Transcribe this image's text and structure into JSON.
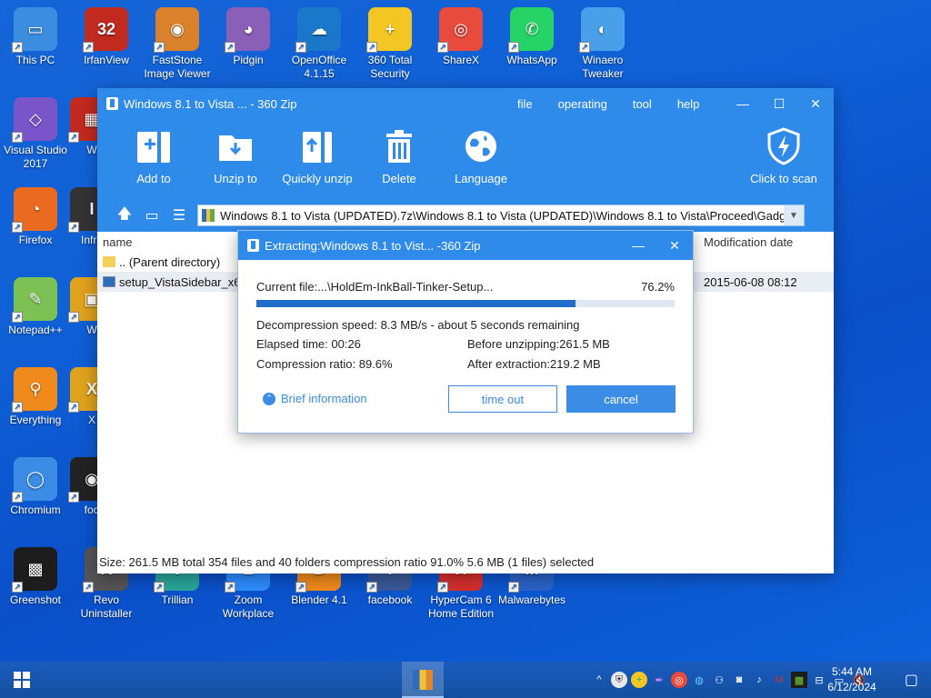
{
  "desktop": {
    "icons": [
      {
        "label": "This PC",
        "color": "#3b8de0",
        "glyph": "▭"
      },
      {
        "label": "IrfanView",
        "color": "#c22a1f",
        "glyph": "32"
      },
      {
        "label": "FastStone Image Viewer",
        "color": "#d9822b",
        "glyph": "◉"
      },
      {
        "label": "Pidgin",
        "color": "#8a5fb8",
        "glyph": "◕"
      },
      {
        "label": "OpenOffice 4.1.15",
        "color": "#1b77c9",
        "glyph": "☁"
      },
      {
        "label": "360 Total Security",
        "color": "#f3c623",
        "glyph": "+"
      },
      {
        "label": "ShareX",
        "color": "#e84a3b",
        "glyph": "◎"
      },
      {
        "label": "WhatsApp",
        "color": "#25d366",
        "glyph": "✆"
      },
      {
        "label": "Winaero Tweaker",
        "color": "#4aa0e8",
        "glyph": "◐"
      },
      {
        "label": "Visual Studio 2017",
        "color": "#7a55c9",
        "glyph": "◇"
      },
      {
        "label": "W",
        "color": "#c22a1f",
        "glyph": "▦"
      },
      {
        "label": "Firefox",
        "color": "#ea6a1f",
        "glyph": "◔"
      },
      {
        "label": "Infra",
        "color": "#333333",
        "glyph": "I"
      },
      {
        "label": "Notepad++",
        "color": "#7cc153",
        "glyph": "✎"
      },
      {
        "label": "W",
        "color": "#e0a31c",
        "glyph": "▣"
      },
      {
        "label": "Everything",
        "color": "#f08a1c",
        "glyph": "⚲"
      },
      {
        "label": "X",
        "color": "#e0a31c",
        "glyph": "X"
      },
      {
        "label": "Chromium",
        "color": "#3a8ce4",
        "glyph": "◯"
      },
      {
        "label": "foo",
        "color": "#222222",
        "glyph": "◉"
      },
      {
        "label": "Greenshot",
        "color": "#1d1d1d",
        "glyph": "▩"
      },
      {
        "label": "Revo Uninstaller",
        "color": "#555555",
        "glyph": "R"
      },
      {
        "label": "Trillian",
        "color": "#2aa59b",
        "glyph": "T"
      },
      {
        "label": "Zoom Workplace",
        "color": "#2d8cff",
        "glyph": "Z"
      },
      {
        "label": "Blender 4.1",
        "color": "#f08a1c",
        "glyph": "B"
      },
      {
        "label": "facebook",
        "color": "#3b5998",
        "glyph": "f"
      },
      {
        "label": "HyperCam 6 Home Edition",
        "color": "#d62e2e",
        "glyph": "H"
      },
      {
        "label": "Malwarebytes",
        "color": "#2b63c7",
        "glyph": "M"
      }
    ]
  },
  "window": {
    "title": "Windows 8.1 to Vista ... - 360 Zip",
    "menu": [
      "file",
      "operating",
      "tool",
      "help"
    ],
    "toolbar": {
      "add_to": "Add to",
      "unzip_to": "Unzip to",
      "quickly_unzip": "Quickly unzip",
      "delete": "Delete",
      "language": "Language",
      "scan": "Click to scan"
    },
    "path": "Windows 8.1 to Vista (UPDATED).7z\\Windows 8.1 to Vista (UPDATED)\\Windows 8.1 to Vista\\Proceed\\Gadg",
    "columns": {
      "name": "name",
      "modified": "Modification date"
    },
    "rows": [
      {
        "name": ".. (Parent directory)",
        "date": ""
      },
      {
        "name": "setup_VistaSidebar_x64",
        "date": "2015-06-08 08:12"
      }
    ],
    "status": "Size: 261.5 MB total 354 files and 40 folders compression ratio 91.0% 5.6 MB (1 files) selected"
  },
  "dialog": {
    "title": "Extracting:Windows 8.1 to Vist... -360 Zip",
    "current_file": "Current file:...\\HoldEm-InkBall-Tinker-Setup...",
    "percent": "76.2%",
    "progress": 0.762,
    "speed": "Decompression speed: 8.3 MB/s -  about 5 seconds remaining",
    "elapsed": "Elapsed time: 00:26",
    "before": "Before unzipping:261.5 MB",
    "ratio": "Compression ratio: 89.6%",
    "after": "After extraction:219.2 MB",
    "brief": "Brief information",
    "timeout_btn": "time out",
    "cancel_btn": "cancel"
  },
  "taskbar": {
    "time": "5:44 AM",
    "date": "6/12/2024"
  }
}
